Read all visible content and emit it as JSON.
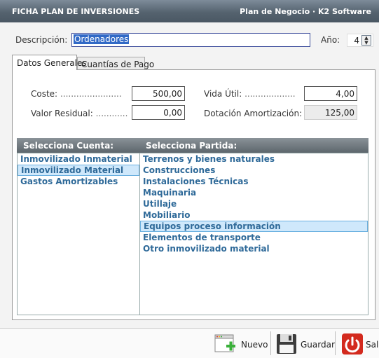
{
  "window": {
    "title": "FICHA PLAN DE INVERSIONES",
    "app": "Plan de Negocio · K2 Software"
  },
  "form": {
    "descripcion_label": "Descripción:",
    "descripcion_value": "Ordenadores",
    "anio_label": "Año:",
    "anio_value": "4"
  },
  "tabs": [
    {
      "label": "Datos Generales",
      "active": true
    },
    {
      "label": "Cuantías de Pago",
      "active": false
    }
  ],
  "fields": {
    "coste": {
      "label": "Coste:",
      "dots": ".......................",
      "value": "500,00"
    },
    "valor_residual": {
      "label": "Valor Residual:",
      "dots": "............",
      "value": "0,00"
    },
    "vida_util": {
      "label": "Vida Útil:",
      "dots": "...................",
      "value": "4,00"
    },
    "dotacion": {
      "label": "Dotación Amortización:",
      "value": "125,00"
    }
  },
  "grid": {
    "cuenta_header": "Selecciona Cuenta:",
    "partida_header": "Selecciona Partida:",
    "cuentas": [
      "Inmovilizado Inmaterial",
      "Inmovilizado Material",
      "Gastos Amortizables"
    ],
    "cuenta_selected": 1,
    "partidas": [
      "Terrenos y bienes naturales",
      "Construcciones",
      "Instalaciones Técnicas",
      "Maquinaria",
      "Utillaje",
      "Mobiliario",
      "Equipos proceso información",
      "Elementos de transporte",
      "Otro inmovilizado material"
    ],
    "partida_selected": 6
  },
  "footer": {
    "nuevo": "Nuevo",
    "guardar": "Guardar",
    "salir": "Salir"
  },
  "colors": {
    "title_bar": "#55636f",
    "list_text": "#2f6a99",
    "selection": "#cfe8fb",
    "exit_red": "#d32a1e"
  }
}
